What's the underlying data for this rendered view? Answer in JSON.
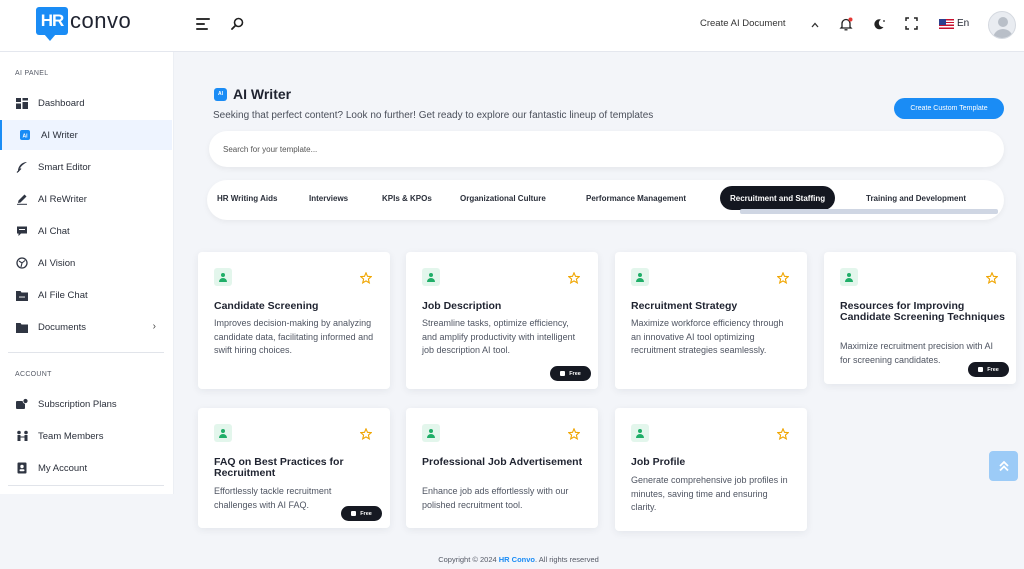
{
  "header": {
    "logo_mark": "HR",
    "logo_text": "convo",
    "create_doc_label": "Create AI Document",
    "lang_label": "En"
  },
  "sidebar": {
    "section_ai": "AI PANEL",
    "items": [
      {
        "label": "Dashboard",
        "icon": "dashboard-icon"
      },
      {
        "label": "AI Writer",
        "icon": "ai-writer-icon"
      },
      {
        "label": "Smart Editor",
        "icon": "feather-icon"
      },
      {
        "label": "AI ReWriter",
        "icon": "pen-icon"
      },
      {
        "label": "AI Chat",
        "icon": "chat-icon"
      },
      {
        "label": "AI Vision",
        "icon": "vision-icon"
      },
      {
        "label": "AI File Chat",
        "icon": "file-chat-icon"
      },
      {
        "label": "Documents",
        "icon": "folder-icon"
      }
    ],
    "section_account": "ACCOUNT",
    "account_items": [
      {
        "label": "Subscription Plans",
        "icon": "subscription-icon"
      },
      {
        "label": "Team Members",
        "icon": "team-icon"
      },
      {
        "label": "My Account",
        "icon": "account-icon"
      }
    ]
  },
  "main": {
    "title_badge": "AI",
    "title": "AI Writer",
    "subtitle": "Seeking that perfect content? Look no further! Get ready to explore our fantastic lineup of templates",
    "custom_button": "Create Custom Template",
    "search_placeholder": "Search for your template...",
    "tabs": [
      "HR Writing Aids",
      "Interviews",
      "KPIs & KPOs",
      "Organizational Culture",
      "Performance Management",
      "Recruitment and Staffing",
      "Training and Development"
    ],
    "active_tab": "Recruitment and Staffing",
    "free_label": "Free",
    "cards": [
      {
        "title": "Candidate Screening",
        "desc": "Improves decision-making by analyzing candidate data, facilitating informed and swift hiring choices.",
        "free": false
      },
      {
        "title": "Job Description",
        "desc": "Streamline tasks, optimize efficiency, and amplify productivity with intelligent job description AI tool.",
        "free": true
      },
      {
        "title": "Recruitment Strategy",
        "desc": "Maximize workforce efficiency through an innovative AI tool optimizing recruitment strategies seamlessly.",
        "free": false
      },
      {
        "title": "Resources for Improving Candidate Screening Techniques",
        "desc": "Maximize recruitment precision with AI for screening candidates.",
        "free": true
      },
      {
        "title": "FAQ on Best Practices for Recruitment",
        "desc": "Effortlessly tackle recruitment challenges with AI FAQ.",
        "free": true
      },
      {
        "title": "Professional Job Advertisement",
        "desc": "Enhance job ads effortlessly with our polished recruitment tool.",
        "free": false
      },
      {
        "title": "Job Profile",
        "desc": "Generate comprehensive job profiles in minutes, saving time and ensuring clarity.",
        "free": false
      }
    ]
  },
  "footer": {
    "prefix": "Copyright © 2024",
    "brand": "HR Convo",
    "suffix": ". All rights reserved"
  },
  "colors": {
    "accent": "#1a8cf5",
    "card_icon_bg": "#e3f6ec",
    "card_icon_fg": "#1fae68",
    "star": "#f0a500",
    "tab_active_bg": "#141720"
  }
}
